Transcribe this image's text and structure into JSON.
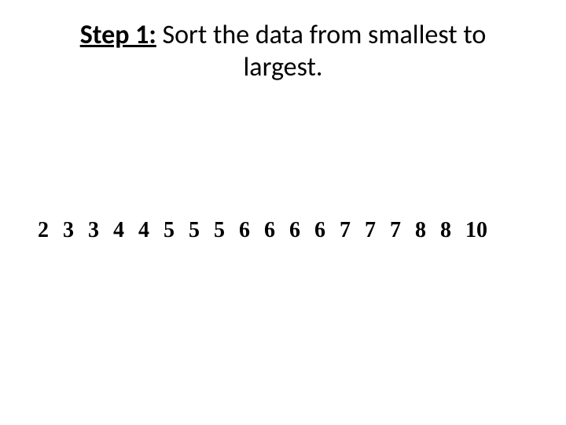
{
  "heading": {
    "step_label": "Step 1:",
    "line1_rest": " Sort the data from smallest to",
    "line2": "largest."
  },
  "data_values": "2 3 3 4 4 5 5 5 6 6 6 6 7 7 7 8 8 10"
}
